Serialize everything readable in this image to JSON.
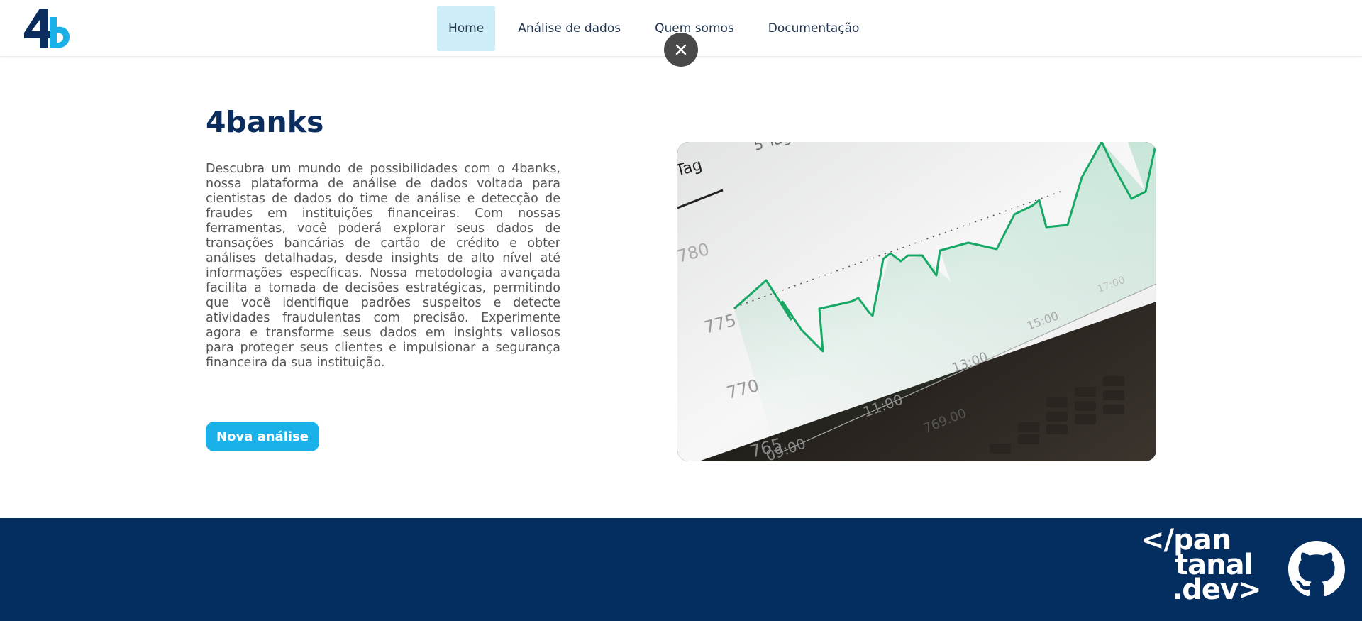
{
  "header": {
    "nav": [
      {
        "label": "Home",
        "active": true
      },
      {
        "label": "Análise de dados",
        "active": false
      },
      {
        "label": "Quem somos",
        "active": false
      },
      {
        "label": "Documentação",
        "active": false
      }
    ],
    "close_icon": "close-icon"
  },
  "main": {
    "title": "4banks",
    "description": "Descubra um mundo de possibilidades com o 4banks, nossa plataforma de análise de dados voltada para cientistas de dados do time de análise e detecção de fraudes em instituições financeiras. Com nossas ferramentas, você poderá explorar seus dados de transações bancárias de cartão de crédito e obter análises detalhadas, desde insights de alto nível até informações específicas. Nossa metodologia avançada facilita a tomada de decisões estratégicas, permitindo que você identifique padrões suspeitos e detecte atividades fraudulentas com precisão. Experimente agora e transforme seus dados em insights valiosos para proteger seus clientes e impulsionar a segurança financeira da sua instituição.",
    "cta_label": "Nova análise",
    "image": {
      "tag_label": "Tag",
      "tag_label_top": "5 Tag",
      "y_ticks": [
        "780",
        "775",
        "770",
        "765"
      ],
      "x_ticks": [
        "09:00",
        "11:00",
        "13:00",
        "15:00",
        "17:00"
      ],
      "misc_text": "769.00"
    }
  },
  "footer": {
    "brand_lines": [
      "</pan",
      "tanal",
      ".dev>"
    ],
    "github_icon": "github-icon"
  },
  "colors": {
    "brand_dark": "#0b2d5e",
    "accent": "#1ab0e8",
    "footer_bg": "#042d60",
    "nav_active_bg": "#cdeef9",
    "chart_line": "#17a866"
  }
}
